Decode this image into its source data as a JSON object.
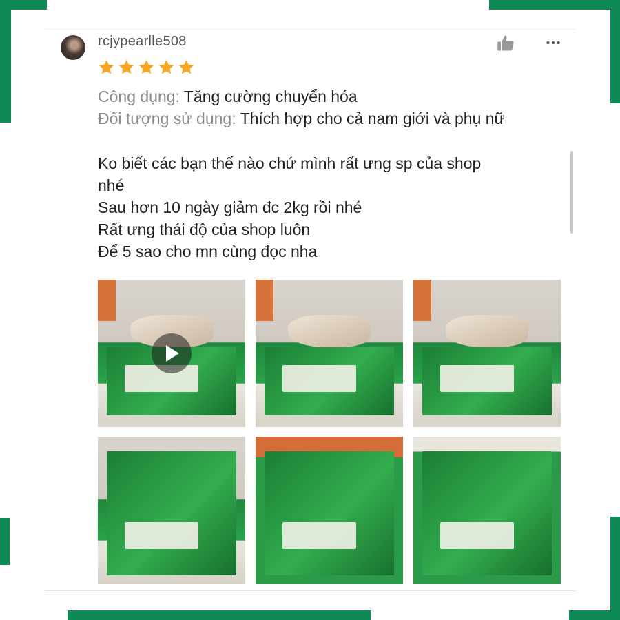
{
  "review": {
    "username": "rcjypearlle508",
    "rating": 5,
    "attributes": [
      {
        "key": "Công dụng:",
        "value": "Tăng cường chuyển hóa"
      },
      {
        "key": "Đối tượng sử dụng:",
        "value": "Thích hợp cho cả nam giới và phụ nữ"
      }
    ],
    "lines": [
      "Ko biết các bạn thế nào chứ mình rất ưng sp của shop",
      "nhé",
      "Sau hơn 10 ngày giảm đc 2kg rồi nhé",
      "Rất ưng thái độ của shop luôn",
      "Để 5 sao cho mn cùng đọc nha"
    ]
  },
  "icons": {
    "like": "thumbs-up-icon",
    "more": "more-horizontal-icon",
    "star": "star-icon",
    "play": "play-icon"
  },
  "colors": {
    "frame": "#0d8a55",
    "star": "#f5a623",
    "username": "#555555",
    "attr_key": "#8a8a8a",
    "text": "#222222"
  }
}
